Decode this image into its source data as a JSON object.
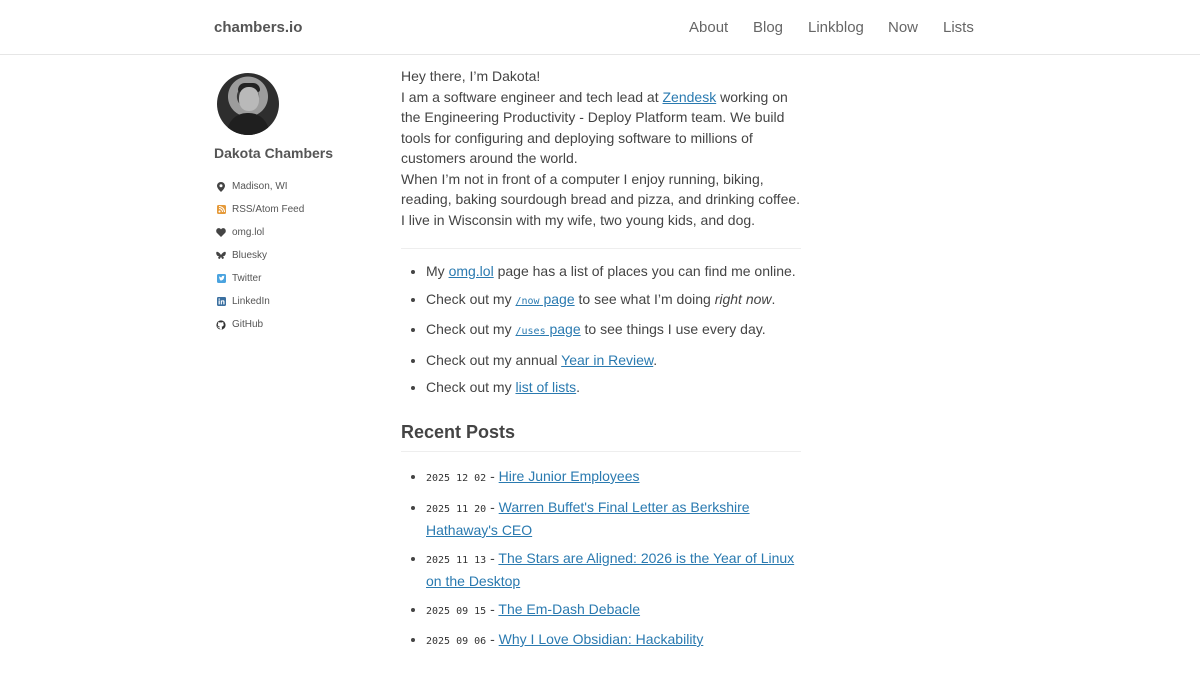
{
  "header": {
    "brand": "chambers.io",
    "nav": [
      "About",
      "Blog",
      "Linkblog",
      "Now",
      "Lists"
    ]
  },
  "sidebar": {
    "name": "Dakota Chambers",
    "links": [
      {
        "label": "Madison, WI",
        "icon": "location-pin-icon"
      },
      {
        "label": "RSS/Atom Feed",
        "icon": "rss-icon"
      },
      {
        "label": "omg.lol",
        "icon": "heart-icon"
      },
      {
        "label": "Bluesky",
        "icon": "butterfly-icon"
      },
      {
        "label": "Twitter",
        "icon": "twitter-icon"
      },
      {
        "label": "LinkedIn",
        "icon": "linkedin-icon"
      },
      {
        "label": "GitHub",
        "icon": "github-icon"
      }
    ]
  },
  "intro": {
    "greeting": "Hey there, I’m Dakota!",
    "p1_before": "I am a software engineer and tech lead at ",
    "p1_link": "Zendesk",
    "p1_after": " working on the Engineering Productivity - Deploy Platform team. We build tools for configuring and deploying software to millions of customers around the world.",
    "p2": "When I’m not in front of a computer I enjoy running, biking, reading, baking sourdough bread and pizza, and drinking coffee. I live in Wisconsin with my wife, two young kids, and dog."
  },
  "checklist": {
    "item1_before": "My ",
    "item1_link": "omg.lol",
    "item1_after": " page has a list of places you can find me online.",
    "item2_before": "Check out my ",
    "item2_code": "/now",
    "item2_link": " page",
    "item2_after_a": " to see what I’m doing ",
    "item2_em": "right now",
    "item2_after_b": ".",
    "item3_before": "Check out my ",
    "item3_code": "/uses",
    "item3_link": " page",
    "item3_after": " to see things I use every day.",
    "item4_before": "Check out my annual ",
    "item4_link": "Year in Review",
    "item4_after": ".",
    "item5_before": "Check out my ",
    "item5_link": "list of lists",
    "item5_after": "."
  },
  "recent": {
    "heading": "Recent Posts",
    "posts": [
      {
        "date": "2025 12 02",
        "title": "Hire Junior Employees"
      },
      {
        "date": "2025 11 20",
        "title": "Warren Buffet's Final Letter as Berkshire Hathaway's CEO"
      },
      {
        "date": "2025 11 13",
        "title": "The Stars are Aligned: 2026 is the Year of Linux on the Desktop"
      },
      {
        "date": "2025 09 15",
        "title": "The Em-Dash Debacle"
      },
      {
        "date": "2025 09 06",
        "title": "Why I Love Obsidian: Hackability"
      }
    ]
  },
  "colors": {
    "link": "#2a7ab0",
    "text": "#444444"
  }
}
